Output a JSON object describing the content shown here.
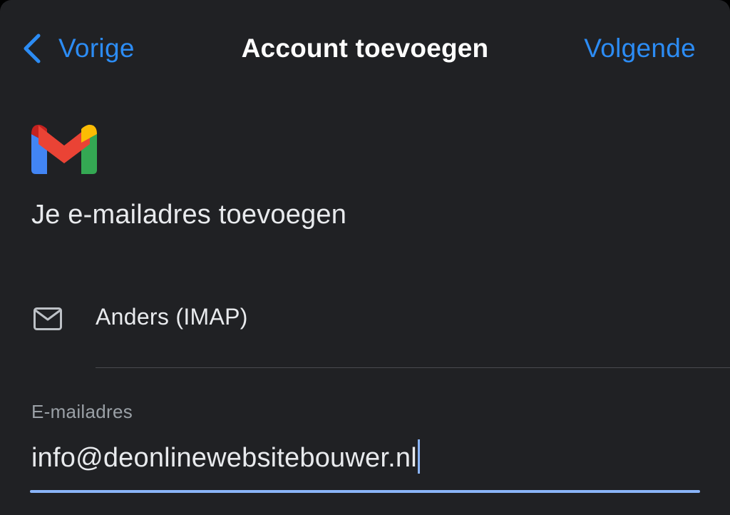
{
  "nav": {
    "back_label": "Vorige",
    "title": "Account toevoegen",
    "next_label": "Volgende"
  },
  "logo": {
    "icon": "gmail-logo-icon"
  },
  "heading": "Je e-mailadres toevoegen",
  "account_type": {
    "icon": "mail-envelope-icon",
    "label": "Anders (IMAP)"
  },
  "email_field": {
    "label": "E-mailadres",
    "value": "info@deonlinewebsitebouwer.nl",
    "focused": true
  },
  "colors": {
    "background": "#202124",
    "accent_blue": "#2c8cf4",
    "focus_blue": "#8ab4f8",
    "text": "#e8eaed",
    "muted_text": "#9aa0a6",
    "gmail_red": "#ea4335",
    "gmail_dark_red": "#c5221f",
    "gmail_blue": "#4285f4",
    "gmail_green": "#34a853",
    "gmail_yellow": "#fbbc04"
  }
}
